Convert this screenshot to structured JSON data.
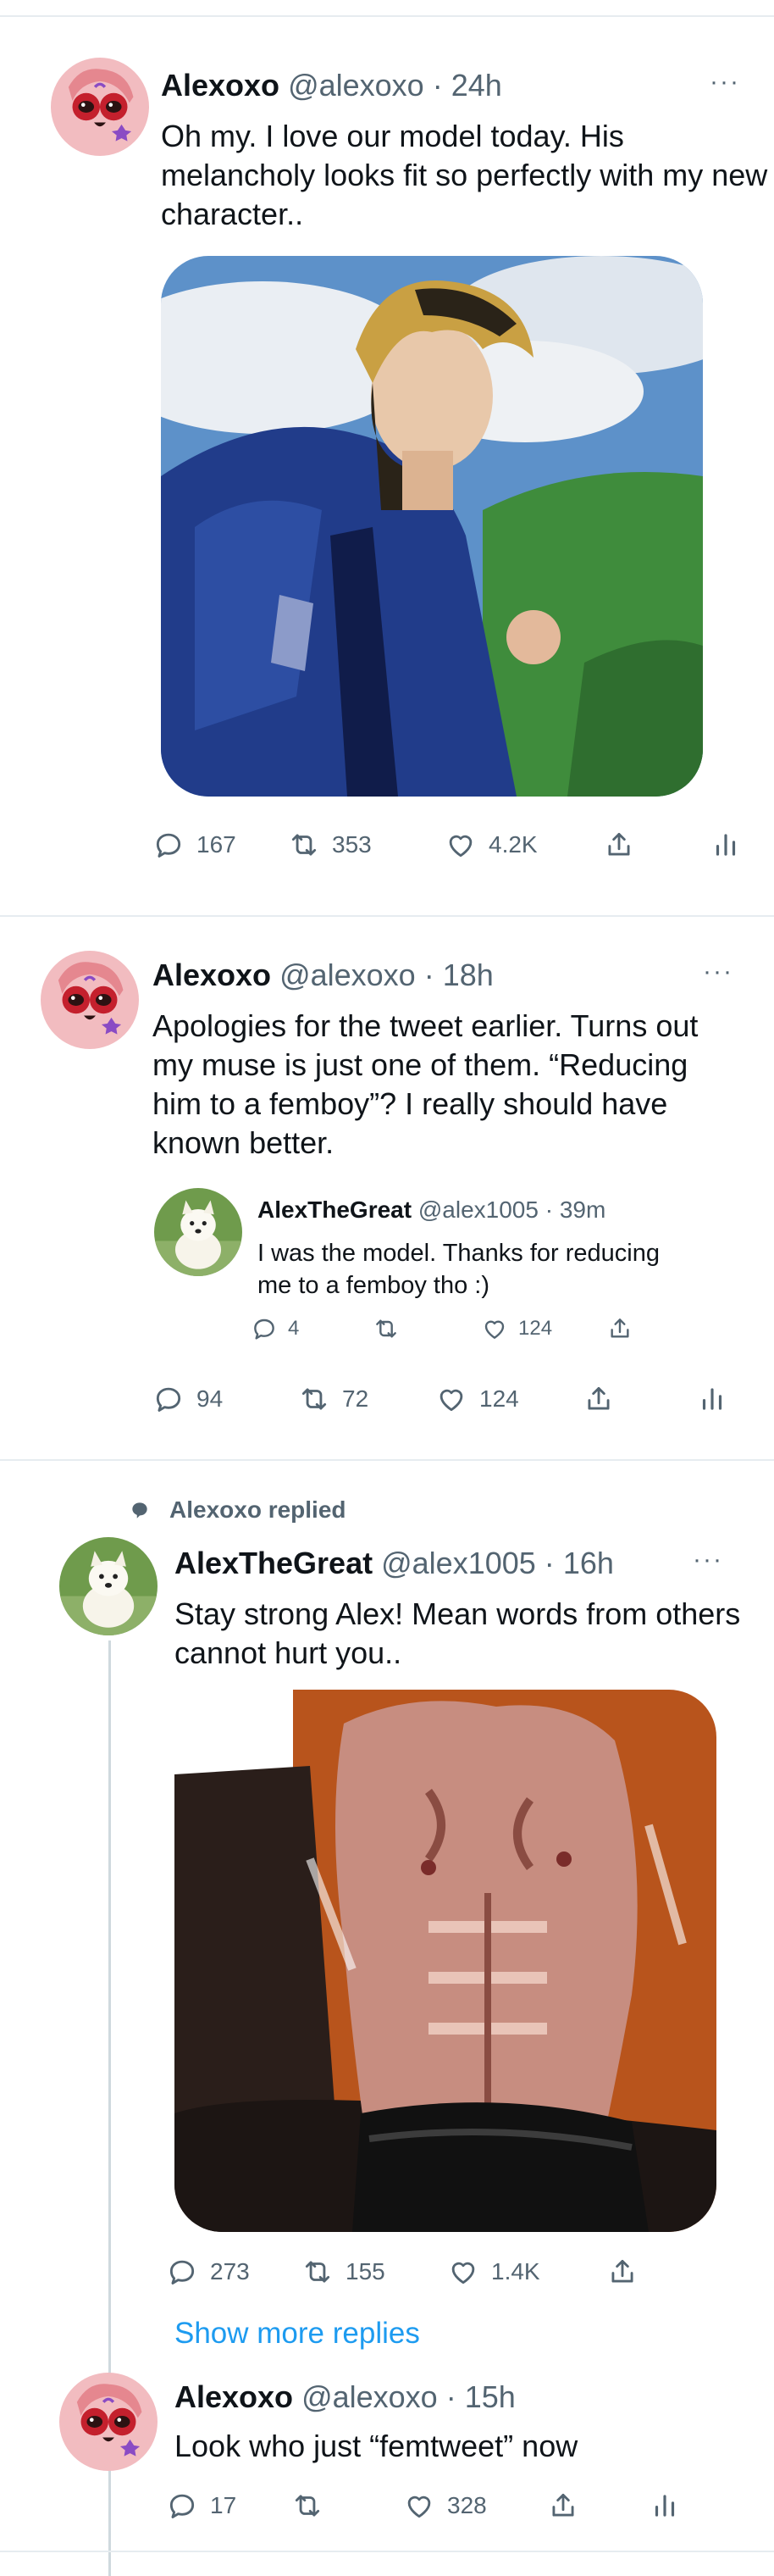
{
  "tweets": [
    {
      "name": "Alexoxo",
      "handle": "@alexoxo",
      "time": "24h",
      "text": "Oh my. I love our model today. His melancholy looks fit so perfectly with my new character..",
      "stats": {
        "replies": "167",
        "retweets": "353",
        "likes": "4.2K"
      }
    },
    {
      "name": "Alexoxo",
      "handle": "@alexoxo",
      "time": "18h",
      "text": "Apologies for the tweet earlier. Turns out my muse is just one of them. “Reducing him to a femboy”? I really should have known better.",
      "quote": {
        "name": "AlexTheGreat",
        "handle": "@alex1005",
        "time": "39m",
        "text": "I was the model. Thanks for reducing me to a femboy tho :)",
        "stats": {
          "replies": "4",
          "likes": "124"
        }
      },
      "stats": {
        "replies": "94",
        "retweets": "72",
        "likes": "124"
      }
    },
    {
      "replied_label": "Alexoxo replied",
      "name": "AlexTheGreat",
      "handle": "@alex1005",
      "time": "16h",
      "text": "Stay strong Alex! Mean words from others cannot hurt you..",
      "stats": {
        "replies": "273",
        "retweets": "155",
        "likes": "1.4K"
      },
      "show_more": "Show more replies"
    },
    {
      "name": "Alexoxo",
      "handle": "@alexoxo",
      "time": "15h",
      "text": "Look who just “femtweet” now",
      "stats": {
        "replies": "17",
        "likes": "328"
      }
    }
  ],
  "colors": {
    "link": "#1d9bf0",
    "secondary": "#536471",
    "border": "#e6ecf0"
  }
}
